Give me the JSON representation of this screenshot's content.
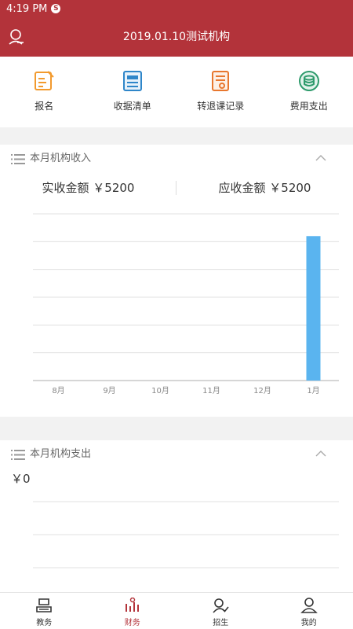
{
  "status": {
    "time": "4:19 PM",
    "badge": "S"
  },
  "header": {
    "title": "2019.01.10测试机构"
  },
  "shortcuts": [
    {
      "label": "报名",
      "icon": "signup-icon"
    },
    {
      "label": "收据清单",
      "icon": "receipt-list-icon"
    },
    {
      "label": "转退课记录",
      "icon": "transfer-record-icon"
    },
    {
      "label": "费用支出",
      "icon": "expense-icon"
    }
  ],
  "income": {
    "title": "本月机构收入",
    "actual": "实收金额 ￥5200",
    "receivable": "应收金额 ￥5200"
  },
  "expense": {
    "title": "本月机构支出",
    "total": "￥0"
  },
  "colors": {
    "brand": "#b3333a",
    "bar": "#5ab4ef",
    "grid": "#e0e0e0"
  },
  "chart_data": {
    "type": "bar",
    "categories": [
      "8月",
      "9月",
      "10月",
      "11月",
      "12月",
      "1月"
    ],
    "values": [
      0,
      0,
      0,
      0,
      0,
      5200
    ],
    "ylim": [
      0,
      6000
    ],
    "grid": true
  },
  "tabs": [
    {
      "label": "教务",
      "icon": "teaching-icon",
      "active": false
    },
    {
      "label": "财务",
      "icon": "finance-icon",
      "active": true
    },
    {
      "label": "招生",
      "icon": "enrollment-icon",
      "active": false
    },
    {
      "label": "我的",
      "icon": "profile-icon",
      "active": false
    }
  ]
}
